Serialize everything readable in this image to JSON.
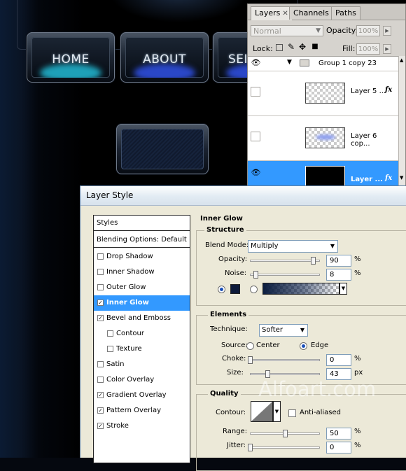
{
  "nav_buttons": {
    "home": "HOME",
    "about": "ABOUT",
    "services": "SEI"
  },
  "layers_panel": {
    "tabs": {
      "layers": "Layers",
      "channels": "Channels",
      "paths": "Paths"
    },
    "blend_mode": "Normal",
    "opacity_label": "Opacity:",
    "opacity_value": "100%",
    "lock_label": "Lock:",
    "fill_label": "Fill:",
    "fill_value": "100%",
    "layers": [
      {
        "name": "Group 1 copy 23",
        "type": "group",
        "visible": true
      },
      {
        "name": "Layer 5 ...",
        "fx": "fx",
        "visible": false
      },
      {
        "name": "Layer 6 cop...",
        "fx": "",
        "visible": false
      },
      {
        "name": "Layer ...",
        "fx": "fx",
        "visible": true,
        "selected": true
      }
    ]
  },
  "dialog": {
    "title": "Layer Style",
    "styles_header": "Styles",
    "blending_options": "Blending Options: Default",
    "style_items": [
      {
        "label": "Drop Shadow",
        "checked": false,
        "indent": false
      },
      {
        "label": "Inner Shadow",
        "checked": false,
        "indent": false
      },
      {
        "label": "Outer Glow",
        "checked": false,
        "indent": false
      },
      {
        "label": "Inner Glow",
        "checked": true,
        "indent": false,
        "selected": true
      },
      {
        "label": "Bevel and Emboss",
        "checked": true,
        "indent": false
      },
      {
        "label": "Contour",
        "checked": false,
        "indent": true
      },
      {
        "label": "Texture",
        "checked": false,
        "indent": true
      },
      {
        "label": "Satin",
        "checked": false,
        "indent": false
      },
      {
        "label": "Color Overlay",
        "checked": false,
        "indent": false
      },
      {
        "label": "Gradient Overlay",
        "checked": true,
        "indent": false
      },
      {
        "label": "Pattern Overlay",
        "checked": true,
        "indent": false
      },
      {
        "label": "Stroke",
        "checked": true,
        "indent": false
      }
    ],
    "inner_glow": {
      "title": "Inner Glow",
      "structure_title": "Structure",
      "blend_mode_label": "Blend Mode:",
      "blend_mode_value": "Multiply",
      "opacity_label": "Opacity:",
      "opacity_value": "90",
      "opacity_pct": 90,
      "noise_label": "Noise:",
      "noise_value": "8",
      "noise_pct": 8,
      "percent": "%",
      "glow_color": "#0d1a3a",
      "elements_title": "Elements",
      "technique_label": "Technique:",
      "technique_value": "Softer",
      "source_label": "Source:",
      "source_center": "Center",
      "source_edge": "Edge",
      "choke_label": "Choke:",
      "choke_value": "0",
      "choke_pct": 0,
      "size_label": "Size:",
      "size_value": "43",
      "size_px": "px",
      "quality_title": "Quality",
      "contour_label": "Contour:",
      "anti_aliased_label": "Anti-aliased",
      "range_label": "Range:",
      "range_value": "50",
      "range_pct": 50,
      "jitter_label": "Jitter:",
      "jitter_value": "0",
      "jitter_pct": 0
    }
  },
  "watermark": "Alfoart.com",
  "colors": {
    "selection": "#3399ff",
    "dialog_bg": "#ece9d8",
    "nav_glow_home": "#1ea0b8",
    "nav_glow_about": "#2a47c8"
  }
}
